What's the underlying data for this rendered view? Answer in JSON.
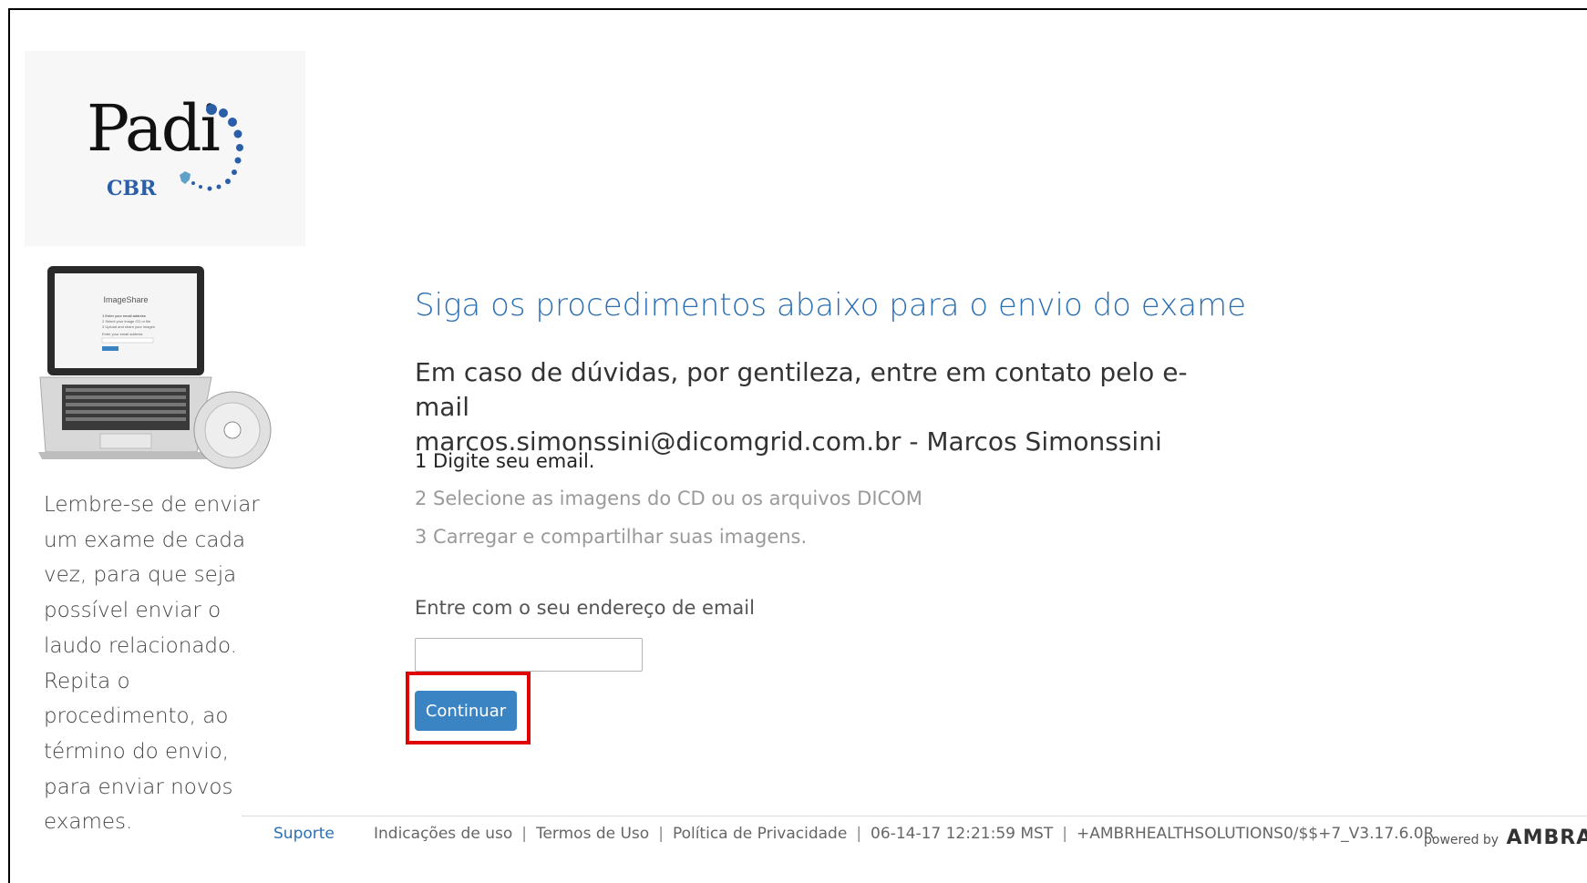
{
  "logo": {
    "main_text": "Padi",
    "sub_text": "CBR"
  },
  "laptop_screen": {
    "title": "ImageShare",
    "lines": [
      "1 Enter your email address",
      "2 Select your image CD or file",
      "3 Upload and share your images",
      "Enter your email address"
    ]
  },
  "sidebar": {
    "lines": [
      "Lembre-se de enviar",
      "um exame de cada",
      "vez, para que seja",
      "possível enviar o",
      "laudo relacionado.",
      "Repita o",
      "procedimento, ao",
      "término do envio,",
      "para enviar novos",
      "exames."
    ]
  },
  "main": {
    "title": "Siga os procedimentos abaixo para o envio do exame",
    "subtitle_line1": "Em caso de dúvidas, por gentileza, entre em contato pelo e-mail",
    "subtitle_line2": "marcos.simonssini@dicomgrid.com.br - Marcos Simonssini",
    "steps": [
      {
        "text": "1 Digite seu email.",
        "active": true
      },
      {
        "text": "2 Selecione as imagens do CD ou os arquivos DICOM",
        "active": false
      },
      {
        "text": "3 Carregar e compartilhar suas imagens.",
        "active": false
      }
    ],
    "email_label": "Entre com o seu endereço de email",
    "email_value": "",
    "continue_label": "Continuar"
  },
  "footer": {
    "support": "Suporte",
    "links": [
      "Indicações de uso",
      "Termos de Uso",
      "Política de Privacidade",
      "06-14-17 12:21:59 MST",
      "+AMBRHEALTHSOLUTIONS0/$$+7_V3.17.6.0R"
    ],
    "powered_by": "powered by",
    "brand": "AMBRA"
  },
  "colors": {
    "accent": "#2b6fb4",
    "button": "#3b84c4",
    "highlight": "#e00000"
  }
}
